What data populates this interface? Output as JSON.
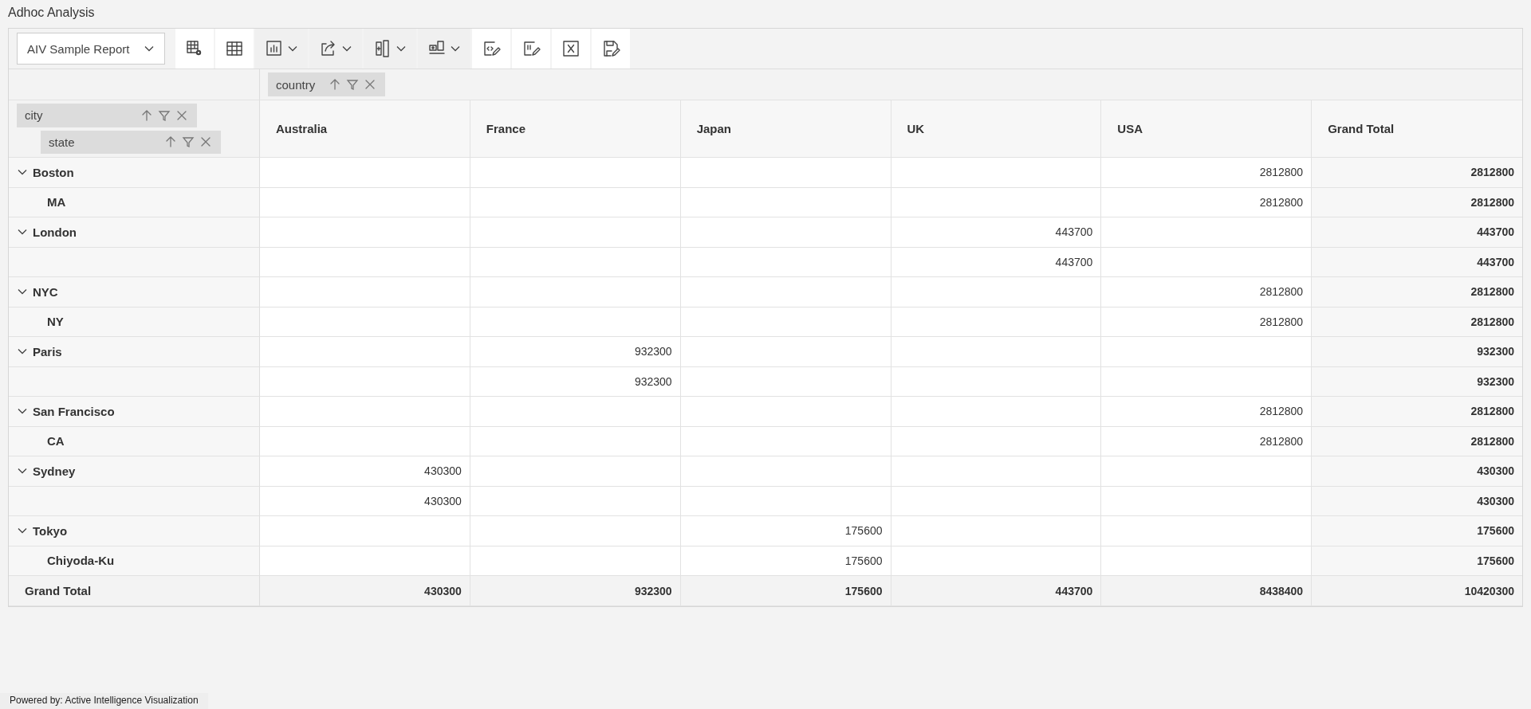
{
  "window": {
    "title": "Adhoc Analysis"
  },
  "toolbar": {
    "report_select": {
      "value": "AIV Sample Report"
    }
  },
  "pivot": {
    "column_fields": [
      {
        "name": "country"
      }
    ],
    "row_fields": [
      {
        "name": "city"
      },
      {
        "name": "state"
      }
    ],
    "columns": [
      "Australia",
      "France",
      "Japan",
      "UK",
      "USA",
      "Grand Total"
    ],
    "rows": [
      {
        "city": "Boston",
        "expanded": true,
        "values": [
          {
            "kind": "empty"
          },
          {
            "kind": "empty"
          },
          {
            "kind": "empty"
          },
          {
            "kind": "empty"
          },
          {
            "kind": "value",
            "value": "2812800"
          },
          {
            "kind": "value",
            "value": "2812800"
          }
        ],
        "children": [
          {
            "state": "MA",
            "values": [
              {
                "kind": "empty"
              },
              {
                "kind": "empty"
              },
              {
                "kind": "empty"
              },
              {
                "kind": "empty"
              },
              {
                "kind": "value",
                "value": "2812800"
              },
              {
                "kind": "value",
                "value": "2812800"
              }
            ]
          }
        ]
      },
      {
        "city": "London",
        "expanded": true,
        "values": [
          {
            "kind": "empty"
          },
          {
            "kind": "empty"
          },
          {
            "kind": "empty"
          },
          {
            "kind": "value",
            "value": "443700"
          },
          {
            "kind": "empty"
          },
          {
            "kind": "value",
            "value": "443700"
          }
        ],
        "children": [
          {
            "values": [
              {
                "kind": "empty"
              },
              {
                "kind": "empty"
              },
              {
                "kind": "empty"
              },
              {
                "kind": "value",
                "value": "443700"
              },
              {
                "kind": "empty"
              },
              {
                "kind": "value",
                "value": "443700"
              }
            ]
          }
        ]
      },
      {
        "city": "NYC",
        "expanded": true,
        "values": [
          {
            "kind": "empty"
          },
          {
            "kind": "empty"
          },
          {
            "kind": "empty"
          },
          {
            "kind": "empty"
          },
          {
            "kind": "value",
            "value": "2812800"
          },
          {
            "kind": "value",
            "value": "2812800"
          }
        ],
        "children": [
          {
            "state": "NY",
            "values": [
              {
                "kind": "empty"
              },
              {
                "kind": "empty"
              },
              {
                "kind": "empty"
              },
              {
                "kind": "empty"
              },
              {
                "kind": "value",
                "value": "2812800"
              },
              {
                "kind": "value",
                "value": "2812800"
              }
            ]
          }
        ]
      },
      {
        "city": "Paris",
        "expanded": true,
        "values": [
          {
            "kind": "empty"
          },
          {
            "kind": "value",
            "value": "932300"
          },
          {
            "kind": "empty"
          },
          {
            "kind": "empty"
          },
          {
            "kind": "empty"
          },
          {
            "kind": "value",
            "value": "932300"
          }
        ],
        "children": [
          {
            "values": [
              {
                "kind": "empty"
              },
              {
                "kind": "value",
                "value": "932300"
              },
              {
                "kind": "empty"
              },
              {
                "kind": "empty"
              },
              {
                "kind": "empty"
              },
              {
                "kind": "value",
                "value": "932300"
              }
            ]
          }
        ]
      },
      {
        "city": "San Francisco",
        "expanded": true,
        "values": [
          {
            "kind": "empty"
          },
          {
            "kind": "empty"
          },
          {
            "kind": "empty"
          },
          {
            "kind": "empty"
          },
          {
            "kind": "value",
            "value": "2812800"
          },
          {
            "kind": "value",
            "value": "2812800"
          }
        ],
        "children": [
          {
            "state": "CA",
            "values": [
              {
                "kind": "empty"
              },
              {
                "kind": "empty"
              },
              {
                "kind": "empty"
              },
              {
                "kind": "empty"
              },
              {
                "kind": "value",
                "value": "2812800"
              },
              {
                "kind": "value",
                "value": "2812800"
              }
            ]
          }
        ]
      },
      {
        "city": "Sydney",
        "expanded": true,
        "values": [
          {
            "kind": "value",
            "value": "430300"
          },
          {
            "kind": "empty"
          },
          {
            "kind": "empty"
          },
          {
            "kind": "empty"
          },
          {
            "kind": "empty"
          },
          {
            "kind": "value",
            "value": "430300"
          }
        ],
        "children": [
          {
            "values": [
              {
                "kind": "value",
                "value": "430300"
              },
              {
                "kind": "empty"
              },
              {
                "kind": "empty"
              },
              {
                "kind": "empty"
              },
              {
                "kind": "empty"
              },
              {
                "kind": "value",
                "value": "430300"
              }
            ]
          }
        ]
      },
      {
        "city": "Tokyo",
        "expanded": true,
        "values": [
          {
            "kind": "empty"
          },
          {
            "kind": "empty"
          },
          {
            "kind": "value",
            "value": "175600"
          },
          {
            "kind": "empty"
          },
          {
            "kind": "empty"
          },
          {
            "kind": "value",
            "value": "175600"
          }
        ],
        "children": [
          {
            "state": "Chiyoda-Ku",
            "values": [
              {
                "kind": "empty"
              },
              {
                "kind": "empty"
              },
              {
                "kind": "value",
                "value": "175600"
              },
              {
                "kind": "empty"
              },
              {
                "kind": "empty"
              },
              {
                "kind": "value",
                "value": "175600"
              }
            ]
          }
        ]
      }
    ],
    "grand_total": {
      "label": "Grand Total",
      "values": [
        "430300",
        "932300",
        "175600",
        "443700",
        "8438400",
        "10420300"
      ]
    }
  },
  "footer": {
    "text": "Powered by: Active Intelligence Visualization"
  }
}
